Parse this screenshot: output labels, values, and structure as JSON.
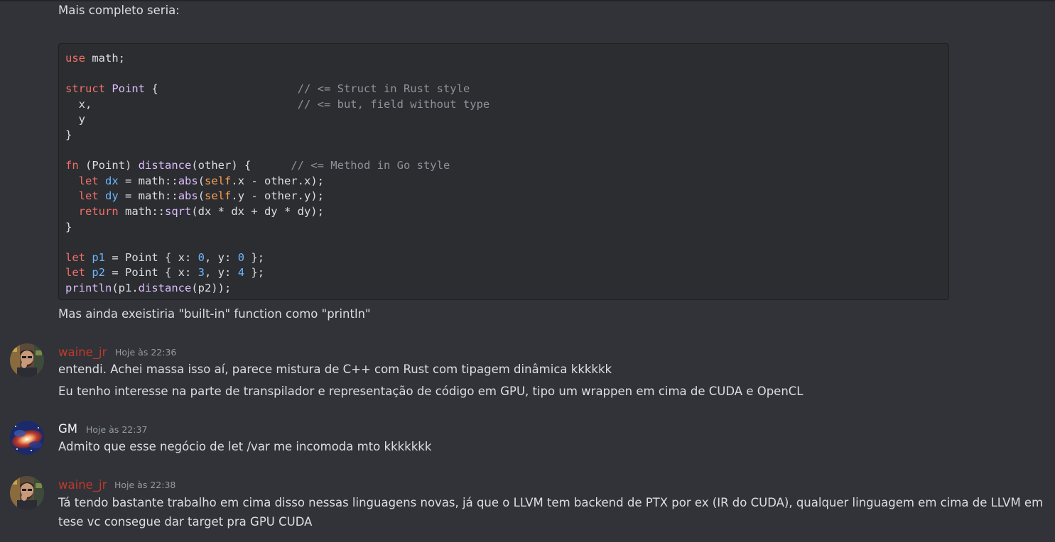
{
  "messages": {
    "intro": "Mais completo seria:",
    "code_lines": [
      [
        [
          "kw",
          "use"
        ],
        [
          "",
          "&nbsp;math;"
        ]
      ],
      [],
      [
        [
          "kw",
          "struct"
        ],
        [
          "",
          "&nbsp;"
        ],
        [
          "ty",
          "Point"
        ],
        [
          "",
          "&nbsp;{&nbsp;&nbsp;&nbsp;&nbsp;&nbsp;&nbsp;&nbsp;&nbsp;&nbsp;&nbsp;&nbsp;&nbsp;&nbsp;&nbsp;&nbsp;&nbsp;&nbsp;&nbsp;&nbsp;&nbsp;&nbsp;"
        ],
        [
          "com",
          "// <= Struct in Rust style"
        ]
      ]
    ],
    "after_code": "Mas ainda exeistiria \"built-in\" function como \"println\""
  },
  "code": [
    "use math;",
    "",
    "struct Point {                     // <= Struct in Rust style",
    "  x,                               // <= but, field without type",
    "  y",
    "}",
    "",
    "fn (Point) distance(other) {      // <= Method in Go style",
    "  let dx = math::abs(self.x - other.x);",
    "  let dy = math::abs(self.y - other.y);",
    "  return math::sqrt(dx * dx + dy * dy);",
    "}",
    "",
    "let p1 = Point { x: 0, y: 0 };",
    "let p2 = Point { x: 3, y: 4 };",
    "println(p1.distance(p2));"
  ],
  "thread": {
    "intro": "Mais completo seria:",
    "after_code": "Mas ainda exeistiria \"built-in\" function como \"println\"",
    "m1": {
      "author": "waine_jr",
      "time": "Hoje às 22:36",
      "line1": "entendi. Achei massa isso aí, parece mistura de C++ com Rust com tipagem dinâmica kkkkkk",
      "line2": "Eu tenho interesse na parte de transpilador e representação de código em GPU, tipo um wrappen em cima de CUDA e OpenCL"
    },
    "m2": {
      "author": "GM",
      "time": "Hoje às 22:37",
      "line1": "Admito que esse negócio de let /var me incomoda mto kkkkkkk"
    },
    "m3": {
      "author": "waine_jr",
      "time": "Hoje às 22:38",
      "line1": "Tá tendo bastante trabalho em cima disso nessas linguagens novas, já que o LLVM tem backend de PTX por ex (IR do CUDA), qualquer linguagem em cima de LLVM em tese vc consegue dar target pra GPU CUDA"
    }
  },
  "colors": {
    "background": "#313338",
    "codeblock": "#2b2d31",
    "author_red": "#c0392b",
    "keyword": "#f47067",
    "type": "#dcbdfb",
    "number": "#6cb6ff",
    "comment": "#8e9297"
  },
  "icons": {
    "avatar_waine": "person-photo-avatar",
    "avatar_gm": "galaxy-nebula-avatar"
  }
}
